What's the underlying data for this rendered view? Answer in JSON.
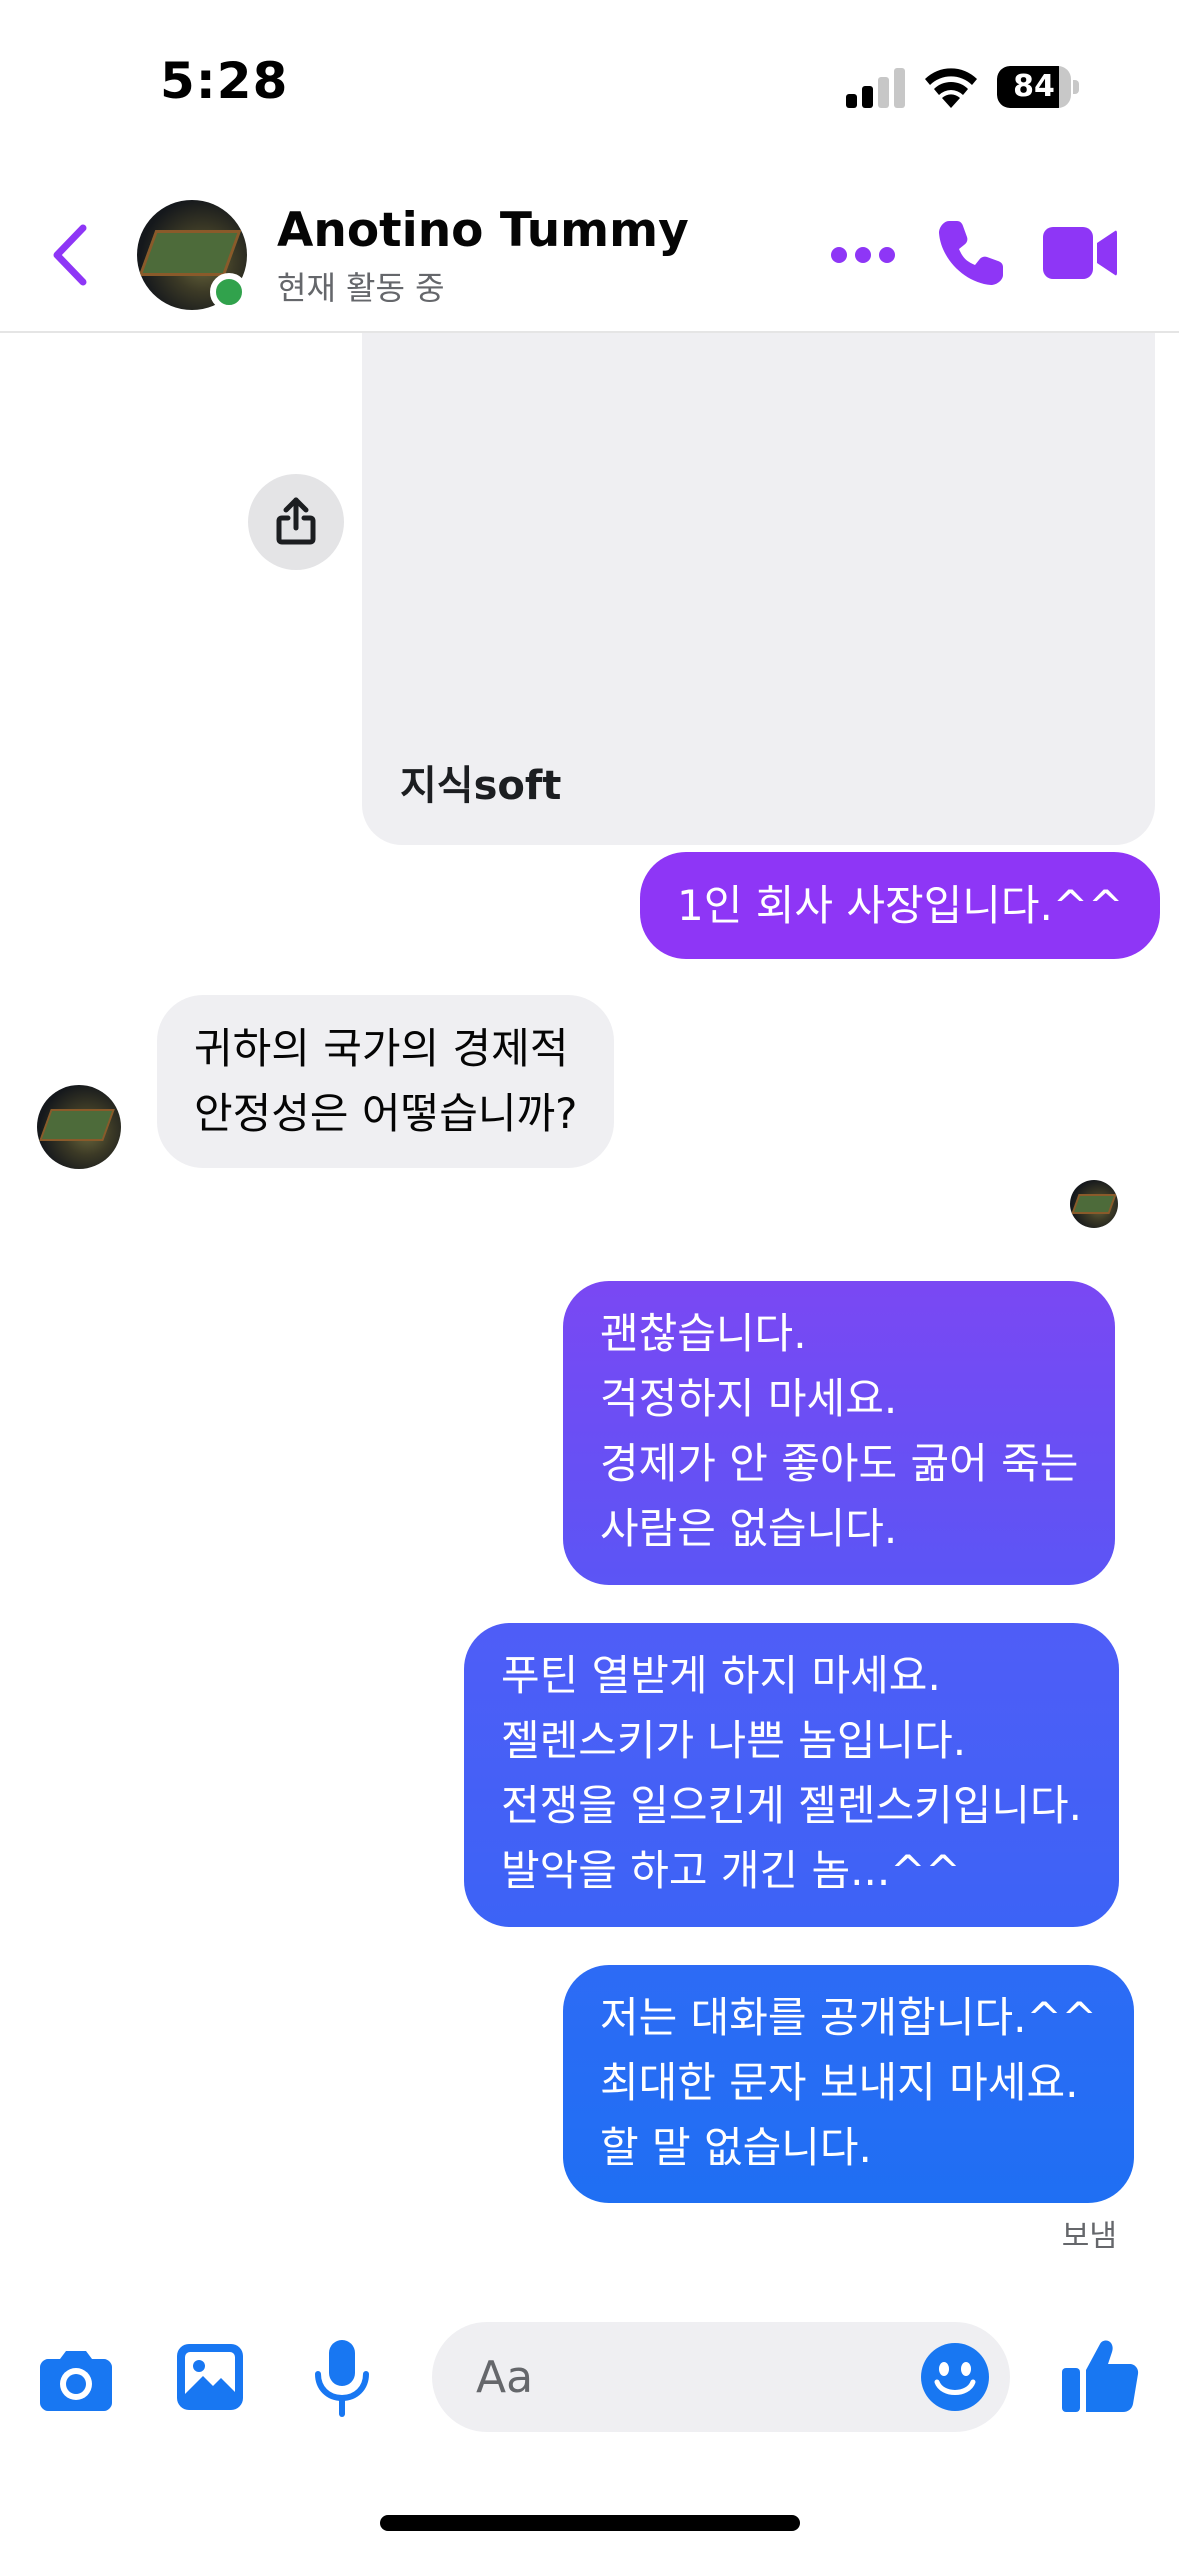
{
  "status_bar": {
    "time": "5:28",
    "battery_level": "84",
    "battery_fraction": 0.84,
    "signal_icon": "cellular-signal-icon",
    "wifi_icon": "wifi-icon"
  },
  "header": {
    "contact_name": "Anotino Tummy",
    "contact_status": "현재 활동 중",
    "back_icon": "chevron-left-icon",
    "more_icon": "more-dots-icon",
    "call_icon": "phone-icon",
    "video_icon": "video-camera-icon"
  },
  "conversation": {
    "link_card_title": "지식soft",
    "share_icon": "share-icon",
    "messages": [
      {
        "direction": "outgoing",
        "text": "1인 회사 사장입니다.^^"
      },
      {
        "direction": "incoming",
        "text": "귀하의 국가의 경제적\n안정성은 어떻습니까?"
      },
      {
        "direction": "outgoing",
        "text": "괜찮습니다.\n걱정하지 마세요.\n경제가 안 좋아도 굶어 죽는\n사람은 없습니다."
      },
      {
        "direction": "outgoing",
        "text": "푸틴 열받게 하지 마세요.\n젤렌스키가 나쁜 놈입니다.\n전쟁을 일으킨게 젤렌스키입니다.\n발악을 하고 개긴 놈...^^"
      },
      {
        "direction": "outgoing",
        "text": "저는 대화를 공개합니다.^^\n최대한 문자 보내지 마세요.\n할 말 없습니다."
      }
    ],
    "sent_status": "보냄"
  },
  "composer": {
    "placeholder": "Aa",
    "camera_icon": "camera-icon",
    "gallery_icon": "image-gallery-icon",
    "mic_icon": "microphone-icon",
    "emoji_icon": "emoji-smile-icon",
    "like_icon": "thumbs-up-icon"
  },
  "colors": {
    "accent_purple": "#8e36f6",
    "accent_blue": "#1f6ff3",
    "online_green": "#31a24c",
    "incoming_bubble": "#efeff2"
  }
}
